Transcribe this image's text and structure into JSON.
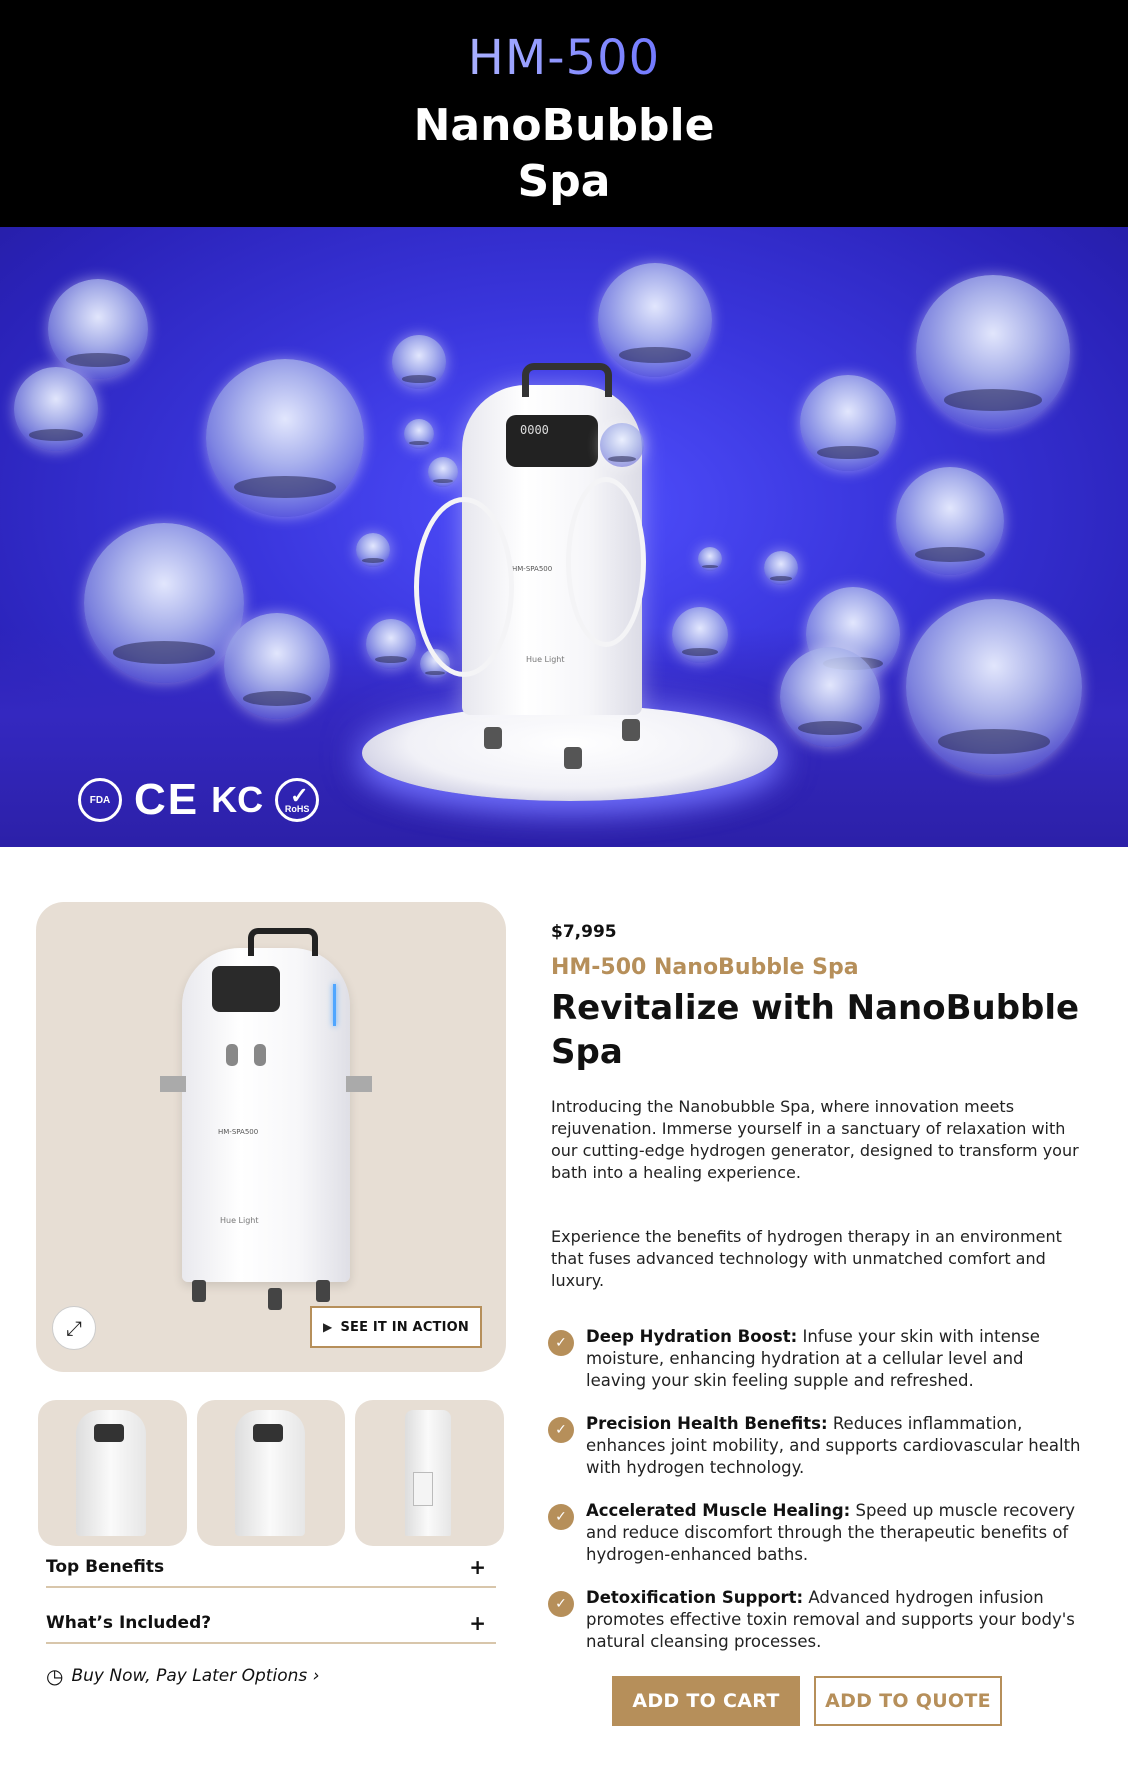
{
  "header": {
    "model": "HM-500",
    "title_line1": "NanoBubble",
    "title_line2": "Spa"
  },
  "hero": {
    "machine_label": "HM-SPA500",
    "machine_brand": "Hue Light",
    "certifications": [
      "FDA",
      "CE",
      "KC",
      "RoHS"
    ]
  },
  "gallery": {
    "machine_label": "HM-SPA500",
    "machine_brand": "Hue Light",
    "expand_icon": "expand-icon",
    "action_button": "SEE IT IN ACTION",
    "thumbnails": [
      "front-angle",
      "front",
      "side"
    ]
  },
  "accordions": [
    {
      "label": "Top Benefits",
      "icon": "+"
    },
    {
      "label": "What’s Included?",
      "icon": "+"
    }
  ],
  "bnpl": {
    "icon": "clock-icon",
    "label": "Buy Now, Pay Later Options ›"
  },
  "product": {
    "price": "$7,995",
    "subtitle": "HM-500 NanoBubble Spa",
    "headline": "Revitalize with NanoBubble Spa",
    "description_1": "Introducing the Nanobubble Spa, where innovation meets rejuvenation. Immerse yourself in a sanctuary of relaxation with our cutting-edge hydrogen generator, designed to transform your bath into a healing experience.",
    "description_2": "Experience the benefits of hydrogen therapy in an environment that fuses advanced technology with unmatched comfort and luxury.",
    "benefits": [
      {
        "title": "Deep Hydration Boost:",
        "text": " Infuse your skin with intense moisture, enhancing hydration at a cellular level and leaving your skin feeling supple and refreshed."
      },
      {
        "title": "Precision Health Benefits:",
        "text": " Reduces inflammation, enhances joint mobility, and supports cardiovascular health with hydrogen technology."
      },
      {
        "title": "Accelerated Muscle Healing:",
        "text": " Speed up muscle recovery and reduce discomfort through the therapeutic benefits of hydrogen-enhanced baths."
      },
      {
        "title": "Detoxification Support:",
        "text": " Advanced hydrogen infusion promotes effective toxin removal and supports your body's natural cleansing processes."
      }
    ],
    "cta_cart": "ADD TO CART",
    "cta_quote": "ADD TO QUOTE"
  },
  "colors": {
    "accent": "#b68f5a",
    "hero_blue": "#3a36dd",
    "gallery_bg": "#e7ded4"
  }
}
